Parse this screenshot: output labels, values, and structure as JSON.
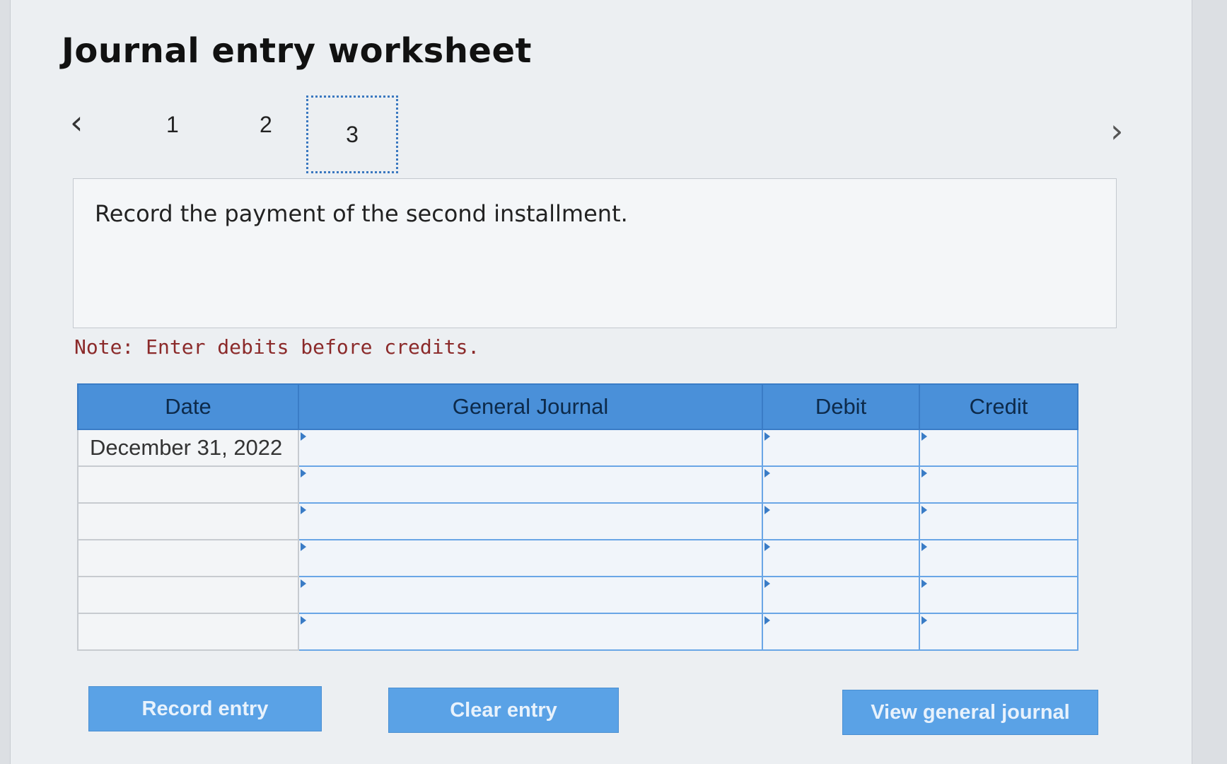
{
  "title": "Journal entry worksheet",
  "navigation": {
    "prev_icon": "chevron-left-icon",
    "next_icon": "chevron-right-icon",
    "steps": [
      "1",
      "2",
      "3"
    ],
    "active_step": "3"
  },
  "instruction": "Record the payment of the second installment.",
  "note": "Note: Enter debits before credits.",
  "table": {
    "headers": {
      "date": "Date",
      "general_journal": "General Journal",
      "debit": "Debit",
      "credit": "Credit"
    },
    "rows": [
      {
        "date": "December 31, 2022",
        "account": "",
        "debit": "",
        "credit": ""
      },
      {
        "date": "",
        "account": "",
        "debit": "",
        "credit": ""
      },
      {
        "date": "",
        "account": "",
        "debit": "",
        "credit": ""
      },
      {
        "date": "",
        "account": "",
        "debit": "",
        "credit": ""
      },
      {
        "date": "",
        "account": "",
        "debit": "",
        "credit": ""
      },
      {
        "date": "",
        "account": "",
        "debit": "",
        "credit": ""
      }
    ]
  },
  "buttons": {
    "record_entry": "Record entry",
    "clear_entry": "Clear entry",
    "view_general_journal": "View general journal"
  },
  "colors": {
    "accent": "#4a90d9",
    "button": "#5aa2e6",
    "note": "#8b2a2a"
  }
}
